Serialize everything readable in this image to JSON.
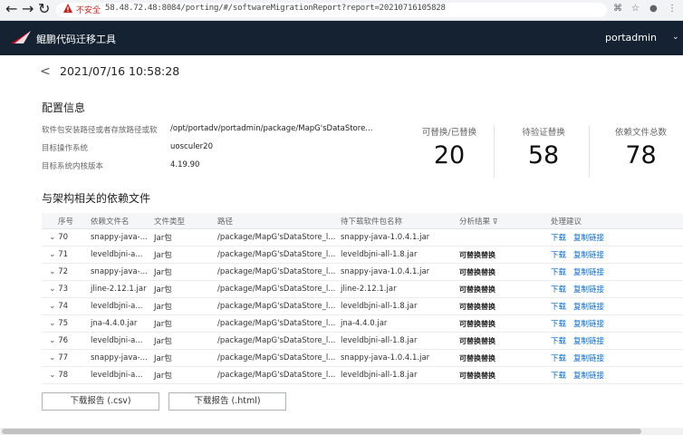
{
  "browser": {
    "insecure_label": "不安全",
    "url": "58.48.72.48:8084/porting/#/softwareMigrationReport?report=20210716105828"
  },
  "app": {
    "title": "鲲鹏代码迁移工具",
    "user": "portadmin"
  },
  "report": {
    "datetime": "2021/07/16 10:58:28"
  },
  "config": {
    "heading": "配置信息",
    "rows": [
      {
        "label": "软件包安装路径或者存放路径或软件包名称",
        "value": "/opt/portadv/portadmin/package/MapG'sDataStore..."
      },
      {
        "label": "目标操作系统",
        "value": "uosculer20"
      },
      {
        "label": "目标系统内核版本",
        "value": "4.19.90"
      }
    ]
  },
  "stats": [
    {
      "label": "可替换/已替换",
      "value": "20"
    },
    {
      "label": "待验证替换",
      "value": "58"
    },
    {
      "label": "依赖文件总数",
      "value": "78"
    }
  ],
  "deps": {
    "heading": "与架构相关的依赖文件",
    "columns": [
      "序号",
      "依赖文件名",
      "文件类型",
      "路径",
      "待下载软件包名称",
      "分析结果",
      "处理建议"
    ],
    "partial_row": {
      "no": "70",
      "name": "snappy-java-...",
      "type": "Jar包",
      "path": "/package/MapG'sDataStore_l...",
      "pkg": "snappy-java-1.0.4.1.jar"
    },
    "rows": [
      {
        "no": "71",
        "name": "leveldbjni-a...",
        "type": "Jar包",
        "path": "/package/MapG'sDataStore_l...",
        "pkg": "leveldbjni-all-1.8.jar",
        "result": "可替换替换"
      },
      {
        "no": "72",
        "name": "snappy-java-...",
        "type": "Jar包",
        "path": "/package/MapG'sDataStore_l...",
        "pkg": "snappy-java-1.0.4.1.jar",
        "result": "可替换替换"
      },
      {
        "no": "73",
        "name": "jline-2.12.1.jar",
        "type": "Jar包",
        "path": "/package/MapG'sDataStore_l...",
        "pkg": "jline-2.12.1.jar",
        "result": "可替换替换"
      },
      {
        "no": "74",
        "name": "leveldbjni-a...",
        "type": "Jar包",
        "path": "/package/MapG'sDataStore_l...",
        "pkg": "leveldbjni-all-1.8.jar",
        "result": "可替换替换"
      },
      {
        "no": "75",
        "name": "jna-4.4.0.jar",
        "type": "Jar包",
        "path": "/package/MapG'sDataStore_l...",
        "pkg": "jna-4.4.0.jar",
        "result": "可替换替换"
      },
      {
        "no": "76",
        "name": "leveldbjni-a...",
        "type": "Jar包",
        "path": "/package/MapG'sDataStore_l...",
        "pkg": "leveldbjni-all-1.8.jar",
        "result": "可替换替换"
      },
      {
        "no": "77",
        "name": "snappy-java-...",
        "type": "Jar包",
        "path": "/package/MapG'sDataStore_l...",
        "pkg": "snappy-java-1.0.4.1.jar",
        "result": "可替换替换"
      },
      {
        "no": "78",
        "name": "leveldbjni-a...",
        "type": "Jar包",
        "path": "/package/MapG'sDataStore_l...",
        "pkg": "leveldbjni-all-1.8.jar",
        "result": "可替换替换"
      }
    ],
    "action_download": "下载",
    "action_copy": "复制链接"
  },
  "buttons": {
    "csv": "下载报告 (.csv)",
    "html": "下载报告 (.html)"
  },
  "colors": {
    "header_bg": "#142232",
    "link": "#0067d1",
    "logo_red": "#d0021b"
  }
}
